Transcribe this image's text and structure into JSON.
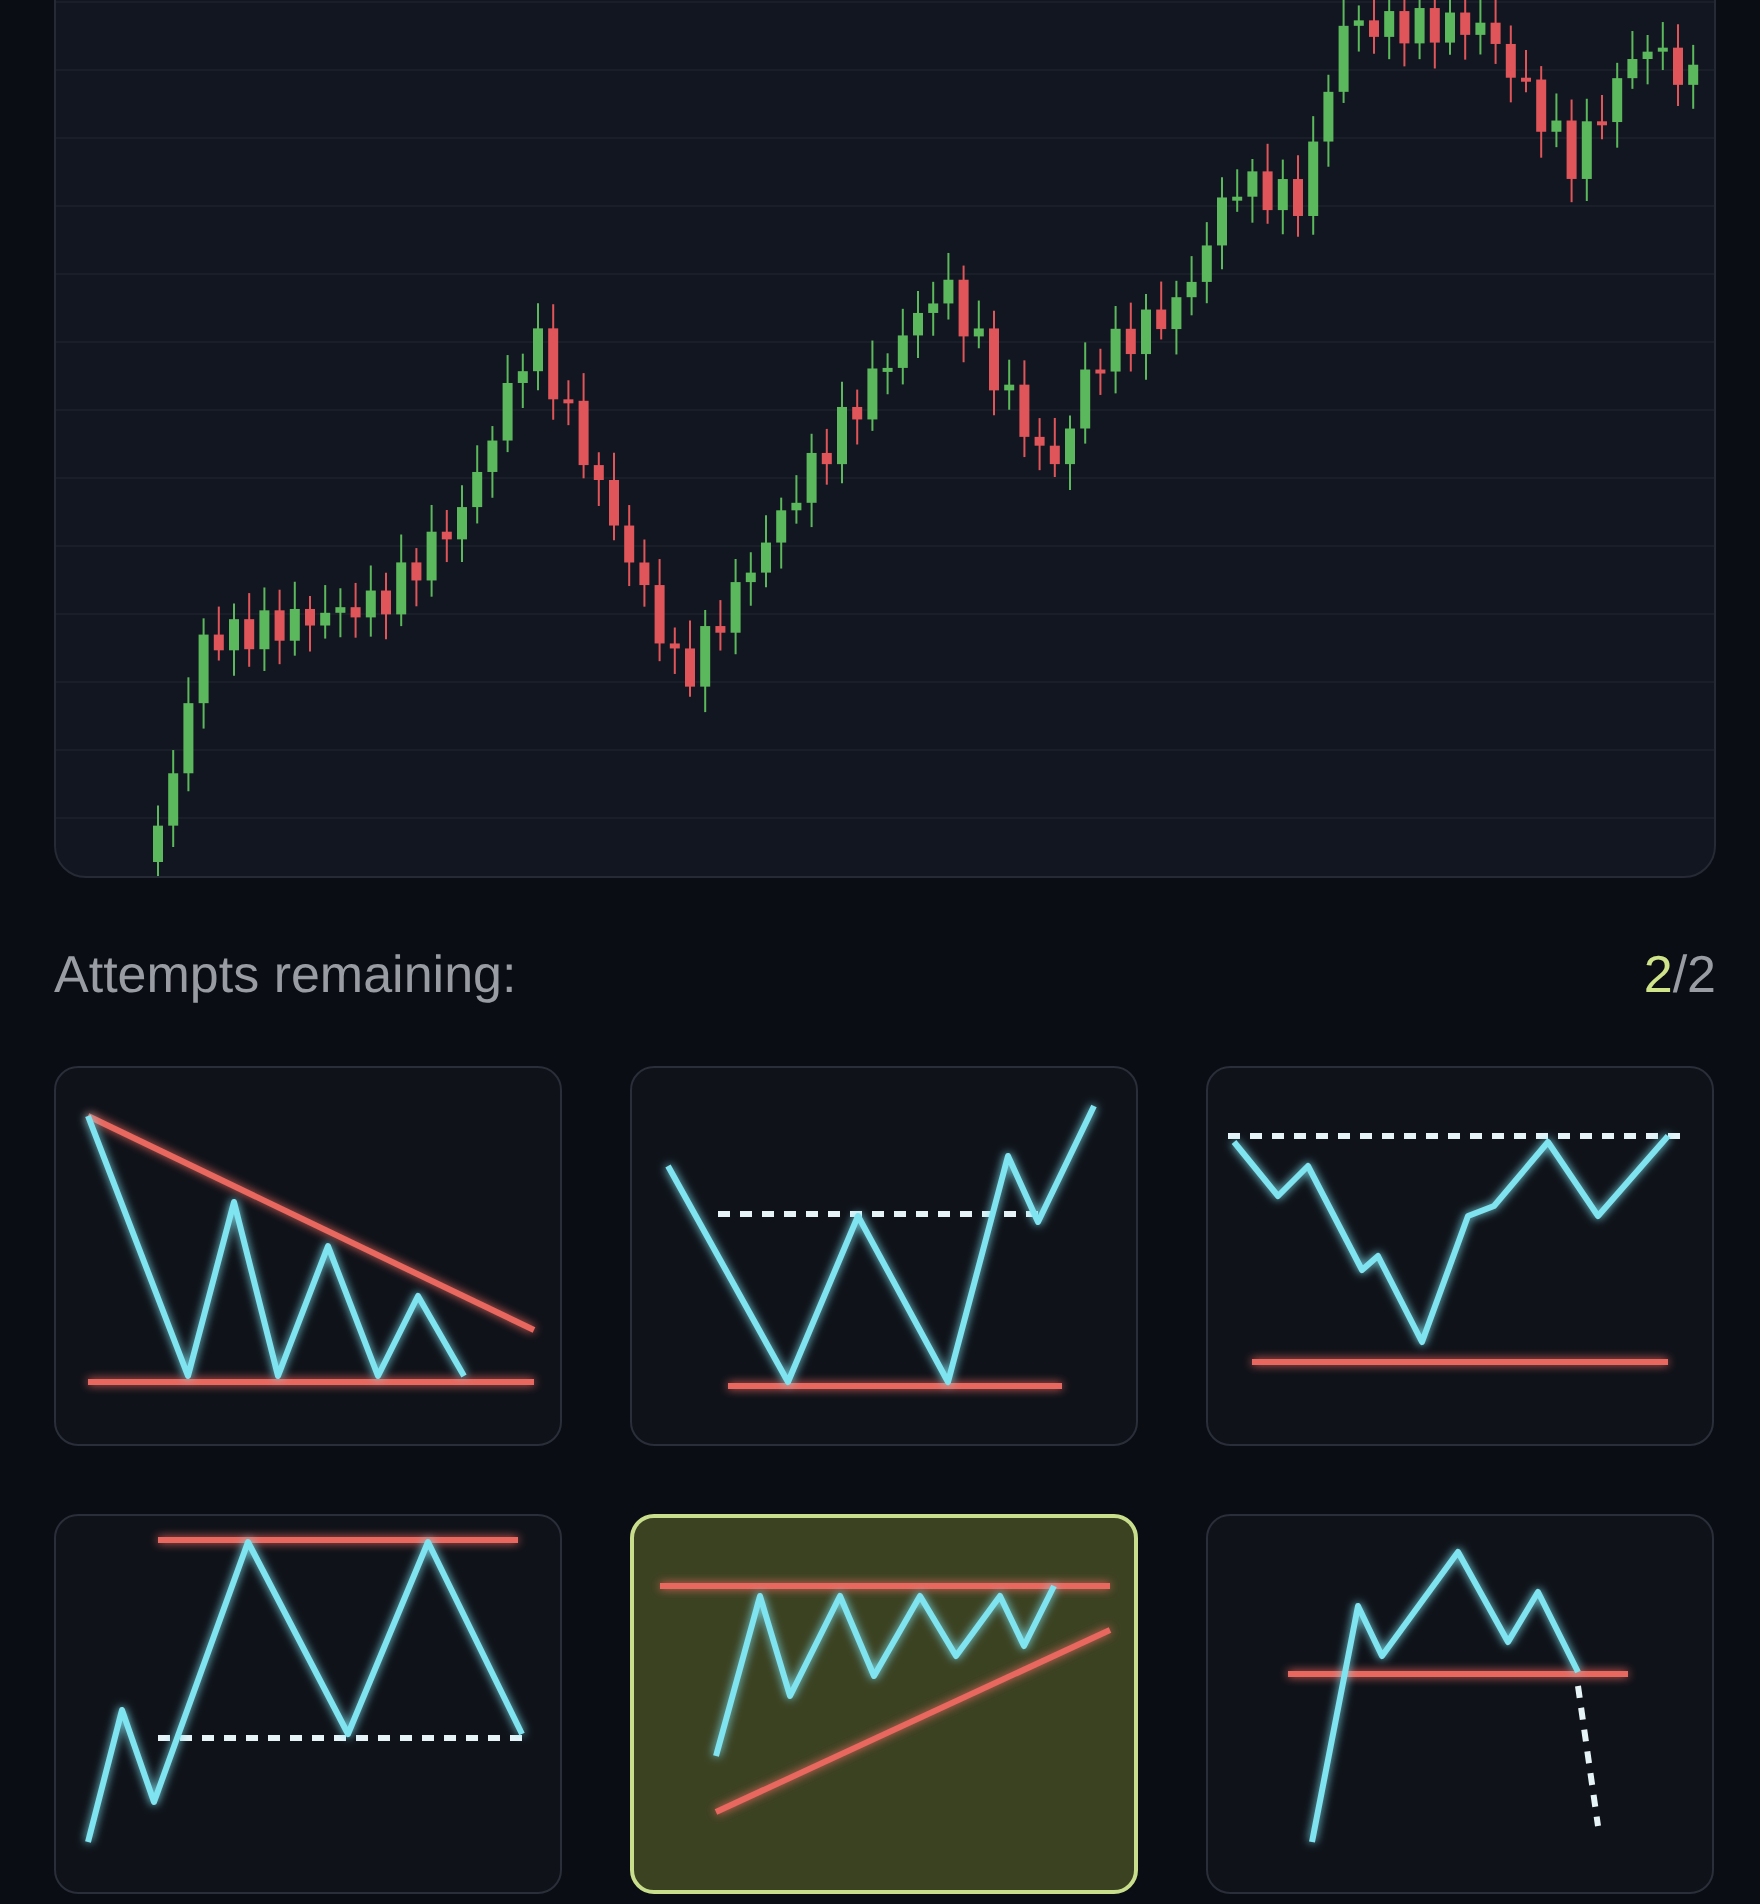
{
  "attempts": {
    "label": "Attempts remaining:",
    "current": "2",
    "rest": "/2"
  },
  "patterns": [
    {
      "kind": "descending_triangle",
      "selected": false
    },
    {
      "kind": "double_bottom",
      "selected": false
    },
    {
      "kind": "inverse_head_shoulders",
      "selected": false
    },
    {
      "kind": "double_top",
      "selected": false
    },
    {
      "kind": "ascending_triangle",
      "selected": true
    },
    {
      "kind": "head_shoulders",
      "selected": false
    }
  ]
}
